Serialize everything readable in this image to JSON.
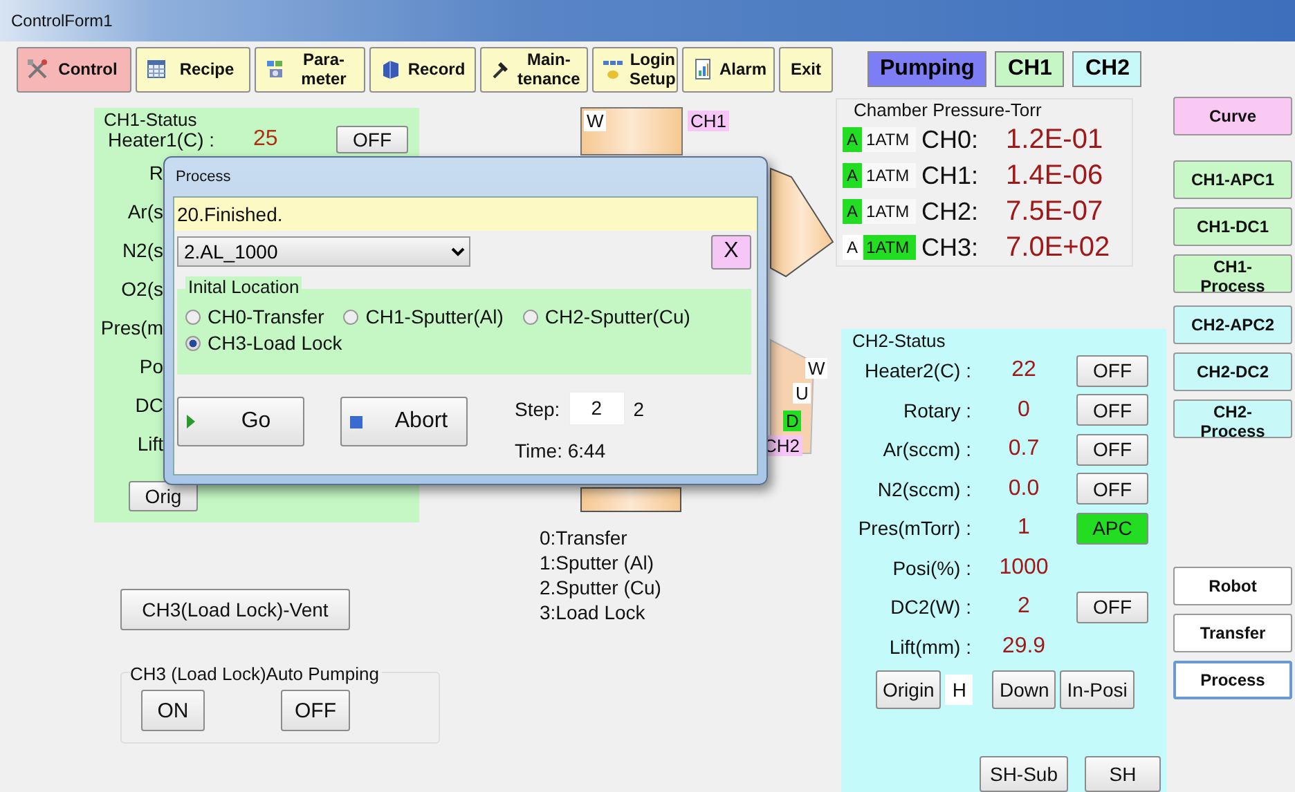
{
  "window": {
    "title": "ControlForm1"
  },
  "toolbar": [
    {
      "label": "Control",
      "selected": true
    },
    {
      "label": "Recipe",
      "selected": false
    },
    {
      "label": "Para-\nmeter",
      "selected": false
    },
    {
      "label": "Record",
      "selected": false
    },
    {
      "label": "Main-\ntenance",
      "selected": false
    },
    {
      "label": "Login\nSetup",
      "selected": false
    },
    {
      "label": "Alarm",
      "selected": false
    },
    {
      "label": "Exit",
      "selected": false
    }
  ],
  "modes": [
    {
      "label": "Pumping",
      "color": "#7e7ef4"
    },
    {
      "label": "CH1",
      "color": "#c6f6c6"
    },
    {
      "label": "CH2",
      "color": "#c8f8f8"
    }
  ],
  "ch1_status": {
    "title": "CH1-Status",
    "rows": [
      {
        "label": "Heater1(C) :",
        "value": "25",
        "button": {
          "label": "OFF",
          "on": false
        }
      },
      {
        "label": "R"
      },
      {
        "label": "Ar(s"
      },
      {
        "label": "N2(s"
      },
      {
        "label": "O2(s"
      },
      {
        "label": "Pres(m"
      },
      {
        "label": "Po"
      },
      {
        "label": "DC"
      },
      {
        "label": "Lift"
      }
    ],
    "buttons": [
      "Orig"
    ]
  },
  "diagram": {
    "top_label": "W",
    "top_chamber": "CH1",
    "side_labels": [
      {
        "label": "W",
        "lit": false
      },
      {
        "label": "U",
        "lit": false
      },
      {
        "label": "D",
        "lit": true
      }
    ],
    "bottom_chamber": "CH2"
  },
  "legend": [
    "0:Transfer",
    "1:Sputter (Al)",
    "2.Sputter (Cu)",
    "3:Load Lock"
  ],
  "vent_button": "CH3(Load Lock)-Vent",
  "auto_pumping": {
    "title": "CH3 (Load Lock)Auto  Pumping",
    "buttons": [
      "ON",
      "OFF"
    ]
  },
  "pressure": {
    "title": "Chamber Pressure-Torr",
    "gauges": [
      {
        "auto": "A",
        "auto_lit": true,
        "atm": "1ATM",
        "atm_lit": false,
        "name": "CH0:",
        "value": "1.2E-01"
      },
      {
        "auto": "A",
        "auto_lit": true,
        "atm": "1ATM",
        "atm_lit": false,
        "name": "CH1:",
        "value": "1.4E-06"
      },
      {
        "auto": "A",
        "auto_lit": true,
        "atm": "1ATM",
        "atm_lit": false,
        "name": "CH2:",
        "value": "7.5E-07"
      },
      {
        "auto": "A",
        "auto_lit": false,
        "atm": "1ATM",
        "atm_lit": true,
        "name": "CH3:",
        "value": "7.0E+02"
      }
    ]
  },
  "ch2_status": {
    "title": "CH2-Status",
    "rows": [
      {
        "label": "Heater2(C) :",
        "value": "22",
        "button": {
          "label": "OFF",
          "on": false
        }
      },
      {
        "label": "Rotary :",
        "value": "0",
        "button": {
          "label": "OFF",
          "on": false
        }
      },
      {
        "label": "Ar(sccm) :",
        "value": "0.7",
        "button": {
          "label": "OFF",
          "on": false
        }
      },
      {
        "label": "N2(sccm) :",
        "value": "0.0",
        "button": {
          "label": "OFF",
          "on": false
        }
      },
      {
        "label": "Pres(mTorr) :",
        "value": "1",
        "button": {
          "label": "APC",
          "on": true
        }
      },
      {
        "label": "Posi(%) :",
        "value": "1000"
      },
      {
        "label": "DC2(W) :",
        "value": "2",
        "button": {
          "label": "OFF",
          "on": false
        }
      },
      {
        "label": "Lift(mm) :",
        "value": "29.9"
      }
    ],
    "lift_buttons": {
      "origin": "Origin",
      "indicator": "H",
      "down": "Down",
      "in_position": "In-Posi"
    },
    "shutter_buttons": [
      "SH-Sub",
      "SH"
    ]
  },
  "side_buttons": [
    {
      "label": "Curve",
      "color": "#f9c8f3",
      "selected": false
    },
    {
      "label": "CH1-APC1",
      "color": "#c8f7c8",
      "selected": false
    },
    {
      "label": "CH1-DC1",
      "color": "#c8f7c8",
      "selected": false
    },
    {
      "label": "CH1-Process",
      "color": "#c8f7c8",
      "selected": false
    },
    {
      "label": "CH2-APC2",
      "color": "#c8f8f8",
      "selected": false
    },
    {
      "label": "CH2-DC2",
      "color": "#c8f8f8",
      "selected": false
    },
    {
      "label": "CH2-Process",
      "color": "#c8f8f8",
      "selected": false
    },
    {
      "label": "Robot",
      "color": "#ffffff",
      "selected": false
    },
    {
      "label": "Transfer",
      "color": "#ffffff",
      "selected": false
    },
    {
      "label": "Process",
      "color": "#ffffff",
      "selected": true
    }
  ],
  "dialog": {
    "title": "Process",
    "status": "20.Finished.",
    "recipe": "2.AL_1000",
    "close": "X",
    "location": {
      "title": "Inital Location",
      "options": [
        {
          "label": "CH0-Transfer",
          "selected": false
        },
        {
          "label": "CH1-Sputter(Al)",
          "selected": false
        },
        {
          "label": "CH2-Sputter(Cu)",
          "selected": false
        },
        {
          "label": "CH3-Load Lock",
          "selected": true
        }
      ]
    },
    "go": "Go",
    "abort": "Abort",
    "step_label": "Step:",
    "step_value": "2",
    "step_total": "2",
    "time": "Time: 6:44"
  }
}
